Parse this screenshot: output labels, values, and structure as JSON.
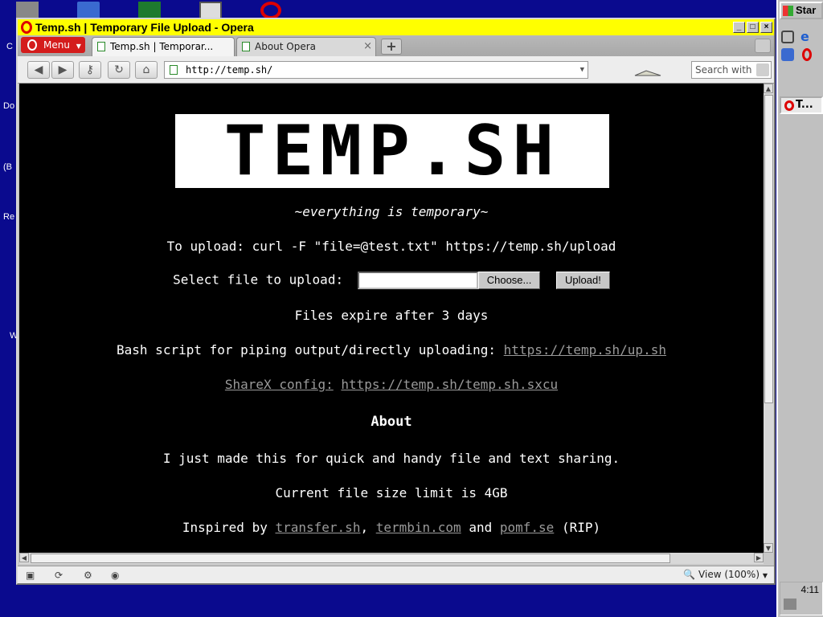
{
  "desktop": {
    "labels": [
      "C",
      "Do",
      "(B",
      "Re",
      "W"
    ]
  },
  "taskbar": {
    "start_label": "Star",
    "task_label": "T...",
    "clock": "4:11"
  },
  "window": {
    "title": "Temp.sh | Temporary File Upload - Opera",
    "controls": {
      "minimize": "_",
      "maximize": "□",
      "close": "×"
    }
  },
  "tabs": {
    "menu_label": "Menu",
    "items": [
      {
        "label": "Temp.sh | Temporar..."
      },
      {
        "label": "About Opera"
      }
    ],
    "close_glyph": "×",
    "new_tab": "+"
  },
  "nav": {
    "url": "http://temp.sh/",
    "search_placeholder": "Search with"
  },
  "page": {
    "logo": "TEMP.SH",
    "tagline": "~everything is temporary~",
    "upload_cmd": "To upload: curl -F \"file=@test.txt\" https://temp.sh/upload",
    "select_label": "Select file to upload:",
    "choose_btn": "Choose...",
    "upload_btn": "Upload!",
    "expire": "Files expire after 3 days",
    "bash_label": "Bash script for piping output/directly uploading:",
    "bash_link": "https://temp.sh/up.sh",
    "sharex_label": "ShareX config:",
    "sharex_link": "https://temp.sh/temp.sh.sxcu",
    "about_heading": "About",
    "about_text": "I just made this for quick and handy file and text sharing.",
    "size_limit": "Current file size limit is 4GB",
    "inspired_prefix": "Inspired by",
    "inspired_links": [
      "transfer.sh",
      "termbin.com",
      "pomf.se"
    ],
    "inspired_and": "and",
    "inspired_suffix": "(RIP)"
  },
  "status": {
    "zoom": "View (100%)"
  },
  "colors": {
    "titlebar": "#ffff00",
    "desktop": "#0a0a8e",
    "opera_red": "#d41c1c",
    "link": "#9a9a9a"
  }
}
